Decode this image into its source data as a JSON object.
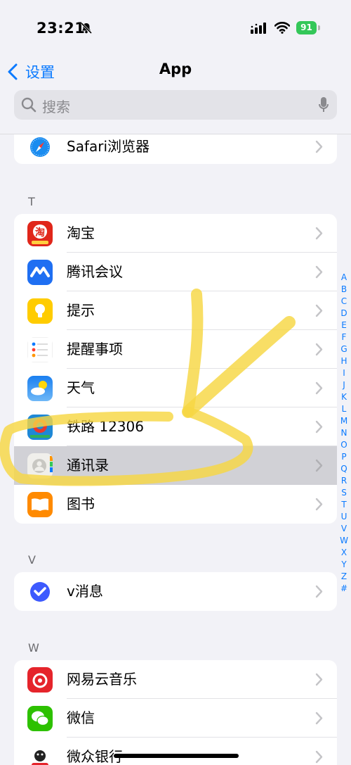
{
  "status": {
    "time": "23:21",
    "battery": "91"
  },
  "nav": {
    "back_label": "设置",
    "title": "App"
  },
  "search": {
    "placeholder": "搜索"
  },
  "groups": {
    "s": {
      "items": [
        {
          "label": "Safari浏览器"
        }
      ]
    },
    "t": {
      "header": "T",
      "items": [
        {
          "label": "淘宝"
        },
        {
          "label": "腾讯会议"
        },
        {
          "label": "提示"
        },
        {
          "label": "提醒事项"
        },
        {
          "label": "天气"
        },
        {
          "label": "铁路 12306"
        },
        {
          "label": "通讯录"
        },
        {
          "label": "图书"
        }
      ]
    },
    "v": {
      "header": "V",
      "items": [
        {
          "label": "v消息"
        }
      ]
    },
    "w": {
      "header": "W",
      "items": [
        {
          "label": "网易云音乐"
        },
        {
          "label": "微信"
        },
        {
          "label": "微众银行"
        }
      ]
    }
  },
  "index_letters": [
    "A",
    "B",
    "C",
    "D",
    "E",
    "F",
    "G",
    "H",
    "I",
    "J",
    "K",
    "L",
    "M",
    "N",
    "O",
    "P",
    "Q",
    "R",
    "S",
    "T",
    "U",
    "V",
    "W",
    "X",
    "Y",
    "Z",
    "#"
  ],
  "colors": {
    "accent": "#0a7aff",
    "highlight_row": "#d1d1d6",
    "scribble": "#f6d743"
  }
}
